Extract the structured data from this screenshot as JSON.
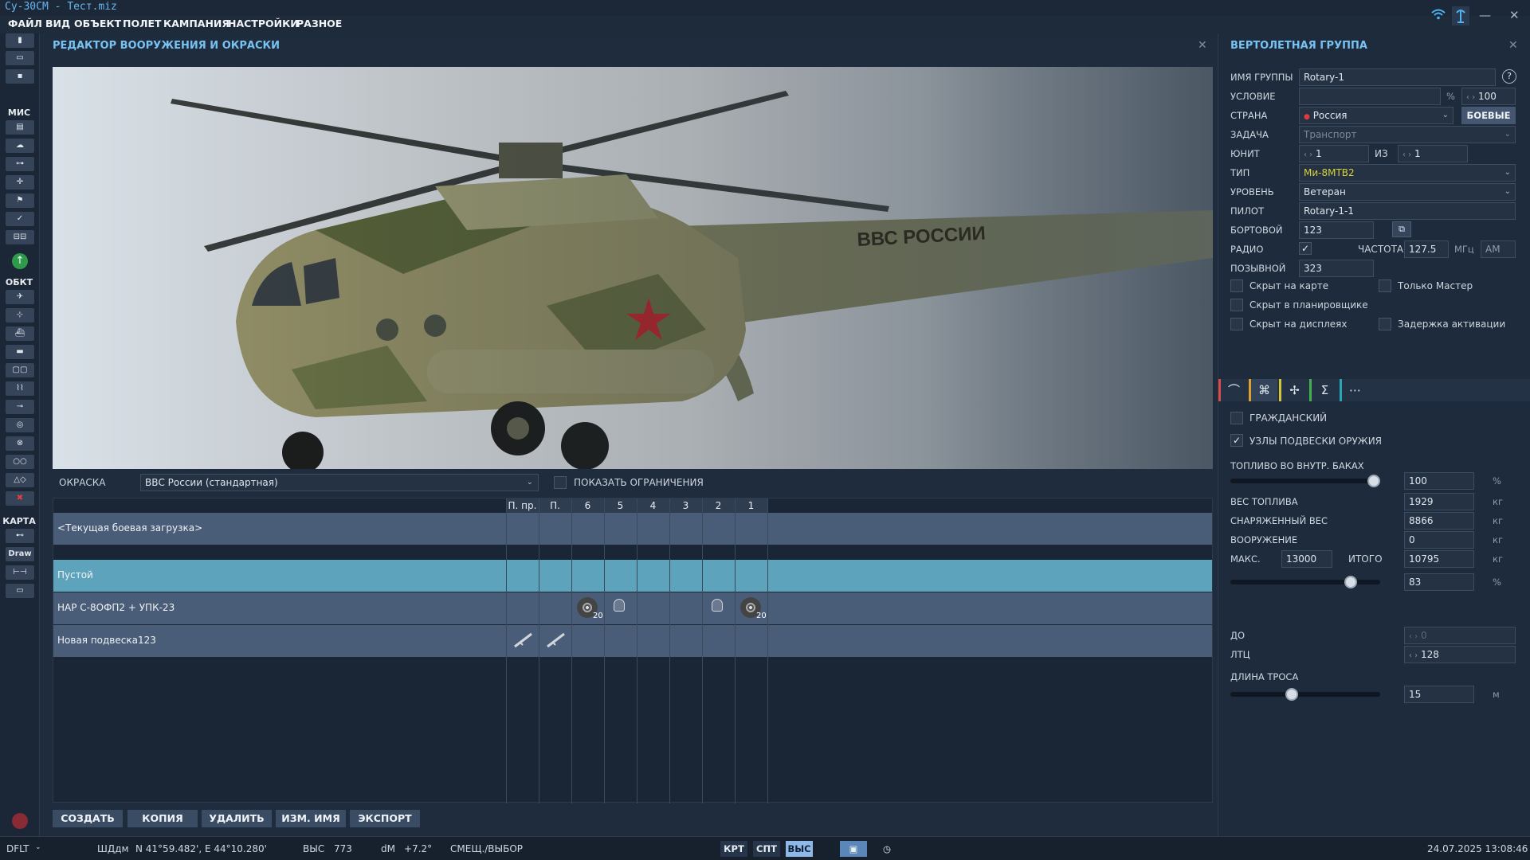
{
  "app_title": "Су-30СМ - Тест.miz",
  "menu": [
    "ФАЙЛ",
    "ВИД",
    "ОБЪЕКТ",
    "ПОЛЕТ",
    "КАМПАНИЯ",
    "НАСТРОЙКИ",
    "РАЗНОЕ"
  ],
  "left_toolbar": {
    "section_mis": "МИС",
    "section_obj": "ОБКТ",
    "section_map": "КАРТА",
    "draw_label": "Draw"
  },
  "editor": {
    "title": "РЕДАКТОР ВООРУЖЕНИЯ И ОКРАСКИ",
    "preview_text": "ВВС РОССИИ",
    "skin_label": "ОКРАСКА",
    "skin_value": "ВВС России (стандартная)",
    "show_limits_label": "ПОКАЗАТЬ ОГРАНИЧЕНИЯ",
    "columns": [
      "П. пр.",
      "П. лев.",
      "6",
      "5",
      "4",
      "3",
      "2",
      "1"
    ],
    "current_loadout": "<Текущая боевая загрузка>",
    "rows": [
      {
        "label": "Пустой"
      },
      {
        "label": "НАР С-8ОФП2 + УПК-23",
        "badge_6": "20",
        "badge_1": "20"
      },
      {
        "label": "Новая подвеска123"
      }
    ],
    "buttons": {
      "create": "СОЗДАТЬ",
      "copy": "КОПИЯ",
      "delete": "УДАЛИТЬ",
      "rename": "ИЗМ. ИМЯ",
      "export": "ЭКСПОРТ"
    }
  },
  "group": {
    "title": "ВЕРТОЛЕТНАЯ ГРУППА",
    "name_label": "ИМЯ ГРУППЫ",
    "name_value": "Rotary-1",
    "help": "?",
    "condition_label": "УСЛОВИЕ",
    "condition_pct": "%",
    "condition_value": "100",
    "country_label": "СТРАНА",
    "country_value": "Россия",
    "combat_button": "БОЕВЫЕ",
    "task_label": "ЗАДАЧА",
    "task_value": "Транспорт",
    "unit_label": "ЮНИТ",
    "unit_value": "1",
    "unit_of": "ИЗ",
    "unit_total": "1",
    "type_label": "ТИП",
    "type_value": "Ми-8МТВ2",
    "level_label": "УРОВЕНЬ",
    "level_value": "Ветеран",
    "pilot_label": "ПИЛОТ",
    "pilot_value": "Rotary-1-1",
    "board_label": "БОРТОВОЙ",
    "board_value": "123",
    "radio_label": "РАДИО",
    "freq_label": "ЧАСТОТА",
    "freq_value": "127.5",
    "freq_unit": "МГц",
    "modulation": "AM",
    "callsign_label": "ПОЗЫВНОЙ",
    "callsign_value": "323",
    "hidden_map": "Скрыт на карте",
    "only_master": "Только Мастер",
    "hidden_planner": "Скрыт в планировщике",
    "hidden_displays": "Скрыт на дисплеях",
    "late_activation": "Задержка активации"
  },
  "payload": {
    "civil_label": "ГРАЖДАНСКИЙ",
    "pylons_label": "УЗЛЫ ПОДВЕСКИ ОРУЖИЯ",
    "fuel_label": "ТОПЛИВО ВО ВНУТР. БАКАХ",
    "fuel_pct": "100",
    "fuel_fraction": 1.0,
    "pct": "%",
    "fuel_weight_label": "ВЕС ТОПЛИВА",
    "fuel_weight": "1929",
    "empty_weight_label": "СНАРЯЖЕННЫЙ ВЕС",
    "empty_weight": "8866",
    "weapons_label": "ВООРУЖЕНИЕ",
    "weapons_weight": "0",
    "max_label": "МАКС.",
    "max_value": "13000",
    "total_label": "ИТОГО",
    "total_value": "10795",
    "kg": "кг",
    "load_pct": "83",
    "load_fraction": 0.83,
    "do_label": "ДО",
    "do_value": "0",
    "ltc_label": "ЛТЦ",
    "ltc_value": "128",
    "rope_label": "ДЛИНА ТРОСА",
    "rope_value": "15",
    "rope_unit": "м",
    "rope_fraction": 0.4
  },
  "statusbar": {
    "profile": "DFLT",
    "coord_label": "ШДдм",
    "coords": "N 41°59.482', E 44°10.280'",
    "alt_label": "ВЫС",
    "alt_value": "773",
    "dm_label": "dM",
    "dm_value": "+7.2°",
    "offset_label": "СМЕЩ./ВЫБОР",
    "krt": "КРТ",
    "spt": "СПТ",
    "vys": "ВЫС",
    "datetime": "24.07.2025 13:08:46"
  },
  "colors": {
    "accent": "#78c2f2",
    "selected_row": "#5da3bc",
    "type_value": "#d8d23a"
  }
}
